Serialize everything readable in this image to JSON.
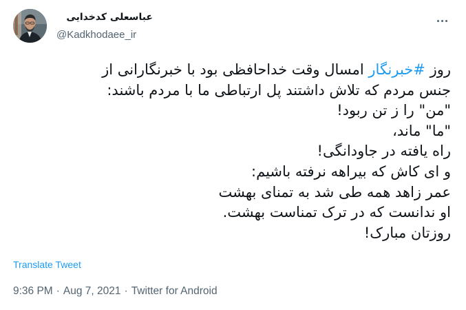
{
  "author": {
    "display_name": "عباسعلی کدخدایی",
    "handle": "@Kadkhodaee_ir",
    "avatar_icon": "profile-photo"
  },
  "menu": {
    "icon": "more-dots-icon"
  },
  "tweet": {
    "lines": [
      {
        "prefix": "روز ",
        "hashtag": "#خبرنگار",
        "suffix": " امسال وقت خداحافظی بود با خبرنگارانی از"
      },
      {
        "text": "جنس مردم که تلاش داشتند پل ارتباطی ما با مردم باشند:"
      },
      {
        "text": "\"من\" را ز تن ربود!"
      },
      {
        "text": "\"ما\" ماند،"
      },
      {
        "text": "راه یافته در جاودانگی!"
      },
      {
        "text": "و ای کاش که بیراهه نرفته باشیم:"
      },
      {
        "text": "عمر زاهد همه طی شد به تمنای بهشت"
      },
      {
        "text": "او ندانست که در ترک تمناست بهشت."
      },
      {
        "text": "روزتان مبارک!"
      }
    ]
  },
  "translate_label": "Translate Tweet",
  "meta": {
    "time": "9:36 PM",
    "date": "Aug 7, 2021",
    "separator": "·",
    "client": "Twitter for Android"
  },
  "colors": {
    "link": "#1d9bf0",
    "secondary": "#536471",
    "text": "#0f1419"
  }
}
